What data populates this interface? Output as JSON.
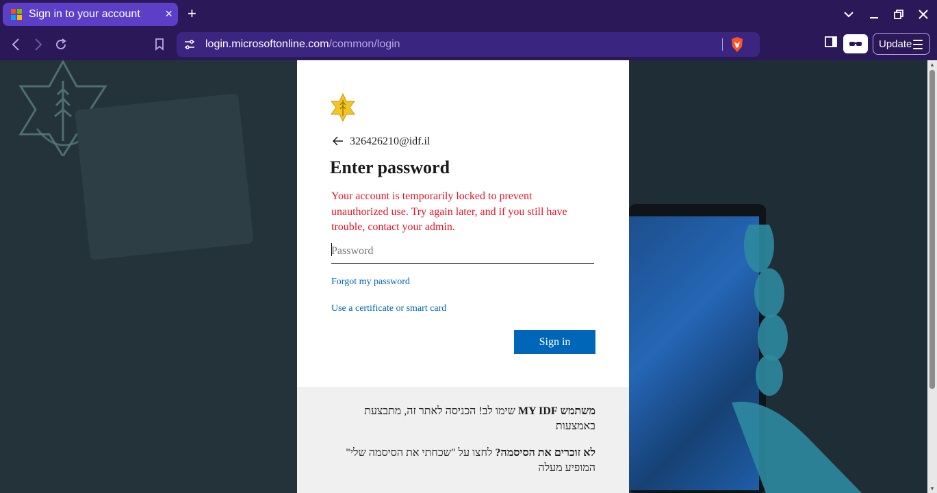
{
  "browser": {
    "tab_title": "Sign in to your account",
    "tab_close": "×",
    "new_tab": "+",
    "url_host": "login.microsoftonline.com",
    "url_path": "/common/login",
    "update_label": "Update",
    "icons": [
      "microsoft-favicon-icon",
      "back-icon",
      "forward-icon",
      "reload-icon",
      "bookmark-icon",
      "site-settings-icon",
      "brave-shield-icon",
      "sidebar-icon",
      "wallet-icon",
      "menu-icon",
      "tab-list-icon",
      "minimize-icon",
      "restore-icon",
      "close-icon"
    ]
  },
  "login": {
    "account": "326426210@idf.il",
    "heading": "Enter password",
    "error": "Your account is temporarily locked to prevent unauthorized use. Try again later, and if you still have trouble, contact your admin.",
    "password_placeholder": "Password",
    "forgot_link": "Forgot my password",
    "certificate_link": "Use a certificate or smart card",
    "signin_label": "Sign in"
  },
  "notice": {
    "line1_plain": "שימו לב! הכניסה לאתר זה, מתבצעת באמצעות",
    "line1_bold": "משתמש MY IDF",
    "line2_bold": "לא זוכרים את הסיסמה?",
    "line2_plain": "לחצו על \"שכחתי את הסיסמה שלי\" המופיע מעלה"
  },
  "colors": {
    "accent": "#0067b8",
    "error": "#e81123",
    "chrome": "#2b1858",
    "tab_active": "#5b3fc7"
  }
}
